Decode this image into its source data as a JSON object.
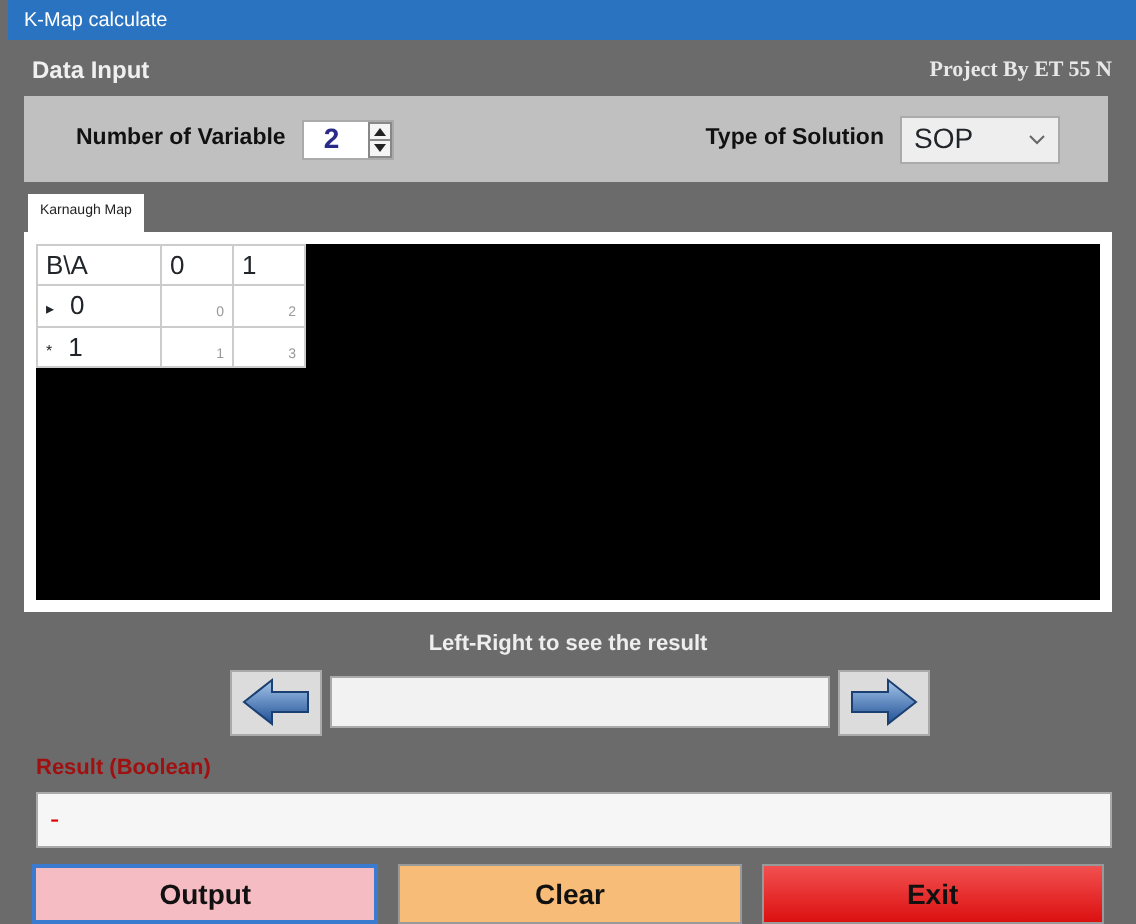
{
  "window": {
    "title": "K-Map calculate"
  },
  "data_input": {
    "heading": "Data Input",
    "credit": "Project By ET 55 N",
    "variable_label": "Number of Variable",
    "variable_value": "2",
    "solution_label": "Type of Solution",
    "solution_value": "SOP"
  },
  "tabs": [
    {
      "label": "Karnaugh Map",
      "selected": true
    }
  ],
  "kmap": {
    "corner": "B\\A",
    "columns": [
      "0",
      "1"
    ],
    "rows": [
      {
        "marker": "▸",
        "label": "0",
        "cells": [
          "0",
          "2"
        ]
      },
      {
        "marker": "*",
        "label": "1",
        "cells": [
          "1",
          "3"
        ]
      }
    ]
  },
  "navigator": {
    "label": "Left-Right to see the result"
  },
  "result": {
    "label": "Result (Boolean)",
    "value": "-"
  },
  "buttons": [
    {
      "label": "Output",
      "kind": "output"
    },
    {
      "label": "Clear",
      "kind": "clear"
    },
    {
      "label": "Exit",
      "kind": "exit"
    }
  ]
}
